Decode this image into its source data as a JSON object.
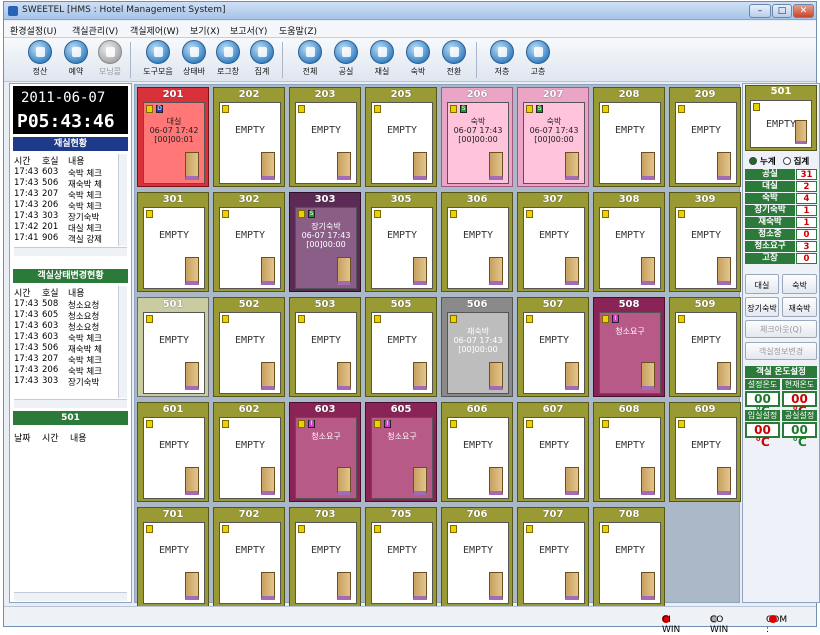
{
  "window": {
    "title": "SWEETEL [HMS : Hotel Management System]",
    "controls": [
      "–",
      "□",
      "✕"
    ]
  },
  "menu": [
    "환경설정(U)",
    "객실관리(V)",
    "객실제어(W)",
    "보기(X)",
    "보고서(Y)",
    "도움말(Z)"
  ],
  "toolbar": [
    {
      "label": "정산",
      "icon": "calculator-icon"
    },
    {
      "label": "예약",
      "icon": "headset-icon"
    },
    {
      "label": "모닝콜",
      "icon": "alarm-icon",
      "disabled": true
    },
    {
      "label": "도구모음",
      "icon": "tools-icon"
    },
    {
      "label": "상태바",
      "icon": "statusbar-icon"
    },
    {
      "label": "로그창",
      "icon": "log-icon"
    },
    {
      "label": "집계",
      "icon": "tally-icon"
    },
    {
      "label": "전체",
      "icon": "building-icon"
    },
    {
      "label": "공실",
      "icon": "door-icon"
    },
    {
      "label": "재실",
      "icon": "person-room-icon"
    },
    {
      "label": "숙박",
      "icon": "bed-icon"
    },
    {
      "label": "전환",
      "icon": "switch-icon"
    },
    {
      "label": "저층",
      "icon": "down-floor-icon"
    },
    {
      "label": "고층",
      "icon": "up-floor-icon"
    }
  ],
  "left": {
    "date": "2011-06-07",
    "time": "P05:43:46",
    "stay_title": "재실현황",
    "headers": [
      "시간",
      "호실",
      "내용"
    ],
    "stay_rows": [
      [
        "17:43",
        "603",
        "숙박 체크"
      ],
      [
        "17:43",
        "506",
        "재숙박 체"
      ],
      [
        "17:43",
        "207",
        "숙박 체크"
      ],
      [
        "17:43",
        "206",
        "숙박 체크"
      ],
      [
        "17:43",
        "303",
        "장기숙박"
      ],
      [
        "17:42",
        "201",
        "대실 체크"
      ],
      [
        "17:41",
        "906",
        "객실 강제"
      ]
    ],
    "change_title": "객실상태변경현황",
    "change_rows": [
      [
        "17:43",
        "508",
        "청소요청"
      ],
      [
        "17:43",
        "605",
        "청소요청"
      ],
      [
        "17:43",
        "603",
        "청소요청"
      ],
      [
        "17:43",
        "603",
        "숙박 체크"
      ],
      [
        "17:43",
        "506",
        "재숙박 체"
      ],
      [
        "17:43",
        "207",
        "숙박 체크"
      ],
      [
        "17:43",
        "206",
        "숙박 체크"
      ],
      [
        "17:43",
        "303",
        "장기숙박"
      ]
    ],
    "room_title": "501",
    "log_headers": [
      "날짜",
      "시간",
      "내용"
    ]
  },
  "rooms": [
    {
      "num": "201",
      "state": "r",
      "tag2": "D",
      "tag2color": "#1f3fcf",
      "text": "대실\n06-07 17:42\n[00]00:01"
    },
    {
      "num": "202",
      "state": "",
      "text": "EMPTY"
    },
    {
      "num": "203",
      "state": "",
      "text": "EMPTY"
    },
    {
      "num": "205",
      "state": "",
      "text": "EMPTY"
    },
    {
      "num": "206",
      "state": "p",
      "tag2": "S",
      "tag2color": "#1d9b2e",
      "text": "숙박\n06-07 17:43\n[00]00:00"
    },
    {
      "num": "207",
      "state": "p",
      "tag2": "S",
      "tag2color": "#1d9b2e",
      "text": "숙박\n06-07 17:43\n[00]00:00"
    },
    {
      "num": "208",
      "state": "",
      "text": "EMPTY"
    },
    {
      "num": "209",
      "state": "",
      "text": "EMPTY"
    },
    {
      "num": "301",
      "state": "",
      "text": "EMPTY"
    },
    {
      "num": "302",
      "state": "",
      "text": "EMPTY"
    },
    {
      "num": "303",
      "state": "pu",
      "tag2": "S",
      "tag2color": "#1d9b2e",
      "text": "장기숙박\n06-07 17:43\n[00]00:00"
    },
    {
      "num": "305",
      "state": "",
      "text": "EMPTY"
    },
    {
      "num": "306",
      "state": "",
      "text": "EMPTY"
    },
    {
      "num": "307",
      "state": "",
      "text": "EMPTY"
    },
    {
      "num": "308",
      "state": "",
      "text": "EMPTY"
    },
    {
      "num": "309",
      "state": "",
      "text": "EMPTY"
    },
    {
      "num": "501",
      "state": "sel",
      "text": "EMPTY"
    },
    {
      "num": "502",
      "state": "",
      "text": "EMPTY"
    },
    {
      "num": "503",
      "state": "",
      "text": "EMPTY"
    },
    {
      "num": "505",
      "state": "",
      "text": "EMPTY"
    },
    {
      "num": "506",
      "state": "g",
      "text": "재숙박\n06-07 17:43\n[00]00:00"
    },
    {
      "num": "507",
      "state": "",
      "text": "EMPTY"
    },
    {
      "num": "508",
      "state": "m",
      "tag2": "T",
      "tag2color": "#d63bd6",
      "text": "청소요구"
    },
    {
      "num": "509",
      "state": "",
      "text": "EMPTY"
    },
    {
      "num": "601",
      "state": "",
      "text": "EMPTY"
    },
    {
      "num": "602",
      "state": "",
      "text": "EMPTY"
    },
    {
      "num": "603",
      "state": "m",
      "tag2": "T",
      "tag2color": "#d63bd6",
      "text": "청소요구"
    },
    {
      "num": "605",
      "state": "m",
      "tag2": "T",
      "tag2color": "#d63bd6",
      "text": "청소요구"
    },
    {
      "num": "606",
      "state": "",
      "text": "EMPTY"
    },
    {
      "num": "607",
      "state": "",
      "text": "EMPTY"
    },
    {
      "num": "608",
      "state": "",
      "text": "EMPTY"
    },
    {
      "num": "609",
      "state": "",
      "text": "EMPTY"
    },
    {
      "num": "701",
      "state": "",
      "text": "EMPTY"
    },
    {
      "num": "702",
      "state": "",
      "text": "EMPTY"
    },
    {
      "num": "703",
      "state": "",
      "text": "EMPTY"
    },
    {
      "num": "705",
      "state": "",
      "text": "EMPTY"
    },
    {
      "num": "706",
      "state": "",
      "text": "EMPTY"
    },
    {
      "num": "707",
      "state": "",
      "text": "EMPTY"
    },
    {
      "num": "708",
      "state": "",
      "text": "EMPTY"
    }
  ],
  "right": {
    "selected_room": "501",
    "selected_text": "EMPTY",
    "mode_cumulative": "누계",
    "mode_tally": "집계",
    "stats": [
      [
        "공실",
        "31"
      ],
      [
        "대실",
        "2"
      ],
      [
        "숙박",
        "4"
      ],
      [
        "장기숙박",
        "1"
      ],
      [
        "재숙박",
        "1"
      ],
      [
        "청소중",
        "0"
      ],
      [
        "청소요구",
        "3"
      ],
      [
        "고장",
        "0"
      ]
    ],
    "btn_rent": "대실",
    "btn_stay": "숙박",
    "btn_long": "장기숙박",
    "btn_restay": "재숙박",
    "btn_checkout": "체크아웃(Q)",
    "btn_change": "객실정보변경",
    "temp_title": "객실 온도설정",
    "temp_set": "설정온도",
    "temp_now": "현재온도",
    "temp_in": "입실설정",
    "temp_vacant": "공실설정",
    "temp_vals": [
      "00 ℃",
      "00 ℃",
      "00 ℃",
      "00 ℃"
    ]
  },
  "status": {
    "ci": "CI WIN",
    "co": "CO WIN",
    "com": "COM :"
  }
}
